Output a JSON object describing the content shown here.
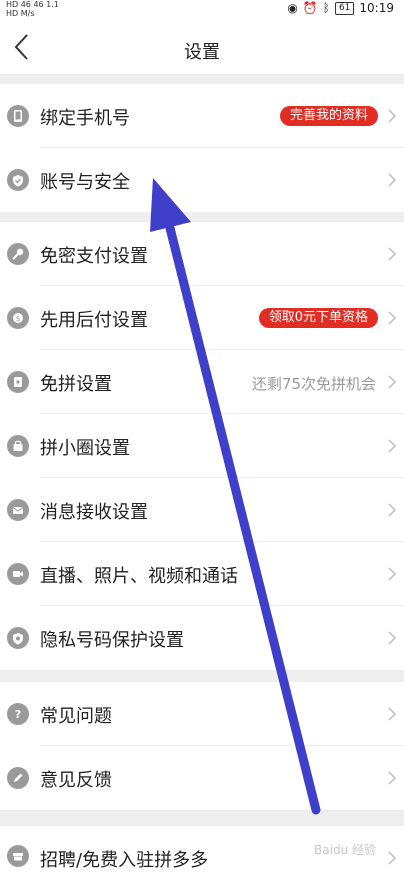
{
  "status": {
    "left_line1": "HD 46 46 1.1",
    "left_line2": "HD M/s",
    "battery": "61",
    "time": "10:19"
  },
  "nav": {
    "title": "设置"
  },
  "items": [
    {
      "label": "绑定手机号",
      "badge": "完善我的资料",
      "icon": "phone-icon"
    },
    {
      "label": "账号与安全",
      "icon": "shield-icon"
    },
    {
      "label": "免密支付设置",
      "icon": "key-icon"
    },
    {
      "label": "先用后付设置",
      "badge": "领取0元下单资格",
      "icon": "badge-icon"
    },
    {
      "label": "免拼设置",
      "right_text": "还剩75次免拼机会",
      "icon": "card-icon"
    },
    {
      "label": "拼小圈设置",
      "icon": "bag-icon"
    },
    {
      "label": "消息接收设置",
      "icon": "mail-icon"
    },
    {
      "label": "直播、照片、视频和通话",
      "icon": "video-icon"
    },
    {
      "label": "隐私号码保护设置",
      "icon": "privacy-shield-icon"
    },
    {
      "label": "常见问题",
      "icon": "question-icon"
    },
    {
      "label": "意见反馈",
      "icon": "pen-icon"
    },
    {
      "label": "招聘/免费入驻拼多多",
      "icon": "shop-icon"
    }
  ],
  "watermark": "Baidu 经验",
  "colors": {
    "badge": "#e02e24",
    "arrow": "#3f3fc9",
    "icon": "#9a9a9a",
    "gap": "#eeeeee"
  }
}
